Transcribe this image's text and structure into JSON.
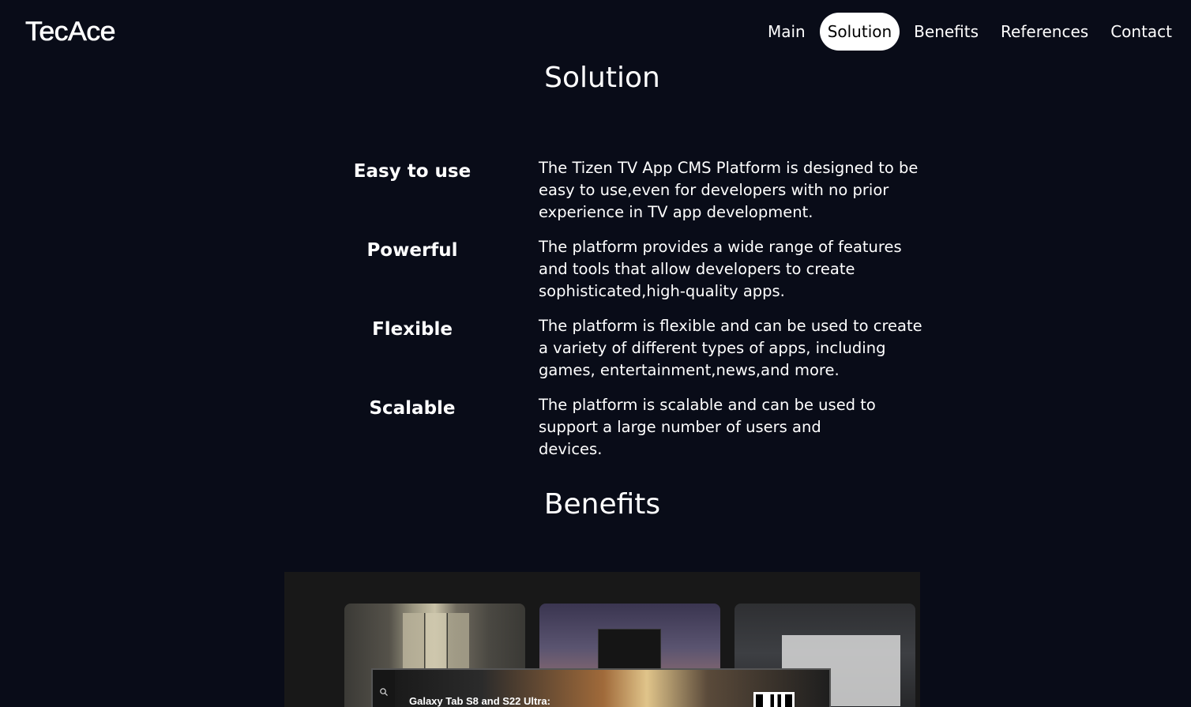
{
  "header": {
    "logo": "TecAce",
    "nav": [
      {
        "label": "Main",
        "active": false
      },
      {
        "label": "Solution",
        "active": true
      },
      {
        "label": "Benefits",
        "active": false
      },
      {
        "label": "References",
        "active": false
      },
      {
        "label": "Contact",
        "active": false
      }
    ]
  },
  "solution": {
    "title": "Solution",
    "features": [
      {
        "name": "Easy to use",
        "description": "The Tizen TV App CMS Platform is designed to be easy to use,even for developers with no prior experience in TV app development."
      },
      {
        "name": "Powerful",
        "description": "The platform provides a wide range of features and tools that allow developers to create sophisticated,high-quality apps."
      },
      {
        "name": "Flexible",
        "description": "The platform is flexible and can be used to create a variety of different types of apps, including games, entertainment,news,and more."
      },
      {
        "name": "Scalable",
        "description": "The platform is scalable and can be used to support a large number of users and devices."
      }
    ]
  },
  "benefits": {
    "title": "Benefits",
    "preview": {
      "caption": "Galaxy Tab S8 and S22 Ultra:",
      "search_icon": "search-icon"
    }
  },
  "colors": {
    "background": "#090c18",
    "text": "#ffffff",
    "active_nav_bg": "#ffffff",
    "active_nav_text": "#000000"
  }
}
